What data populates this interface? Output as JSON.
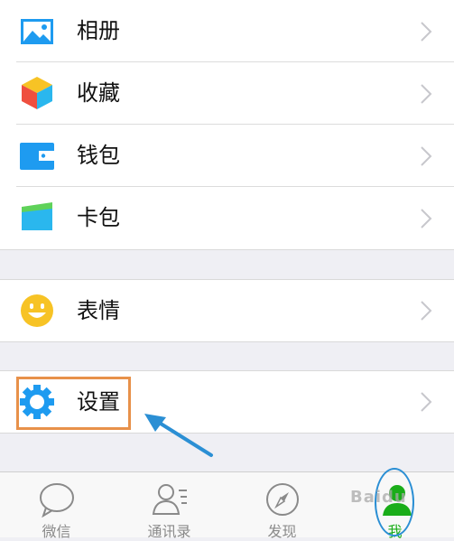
{
  "menu": {
    "album": "相册",
    "favorites": "收藏",
    "wallet": "钱包",
    "cards": "卡包",
    "stickers": "表情",
    "settings": "设置"
  },
  "tabbar": {
    "chats": "微信",
    "contacts": "通讯录",
    "discover": "发现",
    "me": "我"
  },
  "watermark": "Baidu",
  "colors": {
    "accent_green": "#1aad19",
    "highlight_orange": "#e8914a",
    "annotation_blue": "#2b8fd4",
    "icon_blue": "#1e9bf0",
    "icon_yellow": "#f7c325"
  }
}
